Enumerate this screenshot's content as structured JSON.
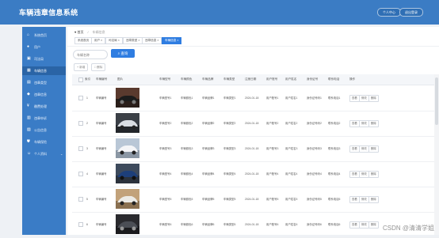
{
  "app": {
    "title": "车辆违章信息系统",
    "top_buttons": [
      "个人中心",
      "退出登录"
    ]
  },
  "sidebar": {
    "items": [
      {
        "label": "系统首页",
        "icon": "home-icon"
      },
      {
        "label": "用户",
        "icon": "user-icon"
      },
      {
        "label": "司法局",
        "icon": "building-icon"
      },
      {
        "label": "车辆信息",
        "icon": "car-icon",
        "active": true
      },
      {
        "label": "违章类型",
        "icon": "list-icon"
      },
      {
        "label": "违章信息",
        "icon": "warning-icon"
      },
      {
        "label": "缴费处理",
        "icon": "money-icon"
      },
      {
        "label": "违章申诉",
        "icon": "appeal-icon"
      },
      {
        "label": "公告信息",
        "icon": "notice-icon"
      },
      {
        "label": "车辆保险",
        "icon": "shield-icon"
      },
      {
        "label": "个人资料",
        "icon": "person-icon",
        "has_submenu": true
      }
    ]
  },
  "breadcrumb": {
    "home": "首页",
    "current": "车辆信息"
  },
  "tags": [
    {
      "label": "系统首页"
    },
    {
      "label": "用户 ×"
    },
    {
      "label": "司法局 ×"
    },
    {
      "label": "违章类型 ×"
    },
    {
      "label": "违章信息 ×"
    },
    {
      "label": "车辆信息 ×",
      "active": true
    }
  ],
  "search": {
    "placeholder": "车辆名称",
    "button_label": "查询"
  },
  "actions": {
    "add": "+ 新增",
    "delete": "删除"
  },
  "table": {
    "columns": [
      "索引",
      "车辆编号",
      "图片",
      "车辆型号",
      "车辆颜色",
      "车辆品牌",
      "车辆类型",
      "注册日期",
      "用户账号",
      "用户姓名",
      "身份证号",
      "联系电话",
      "操作"
    ],
    "rows": [
      {
        "index": "1",
        "vehicle_no": "车辆编号",
        "model": "车辆型号1",
        "color": "车辆颜色1",
        "brand": "车辆品牌1",
        "type": "车辆类型1",
        "date": "2024-01-18",
        "account": "用户账号1",
        "name": "用户姓名1",
        "id_no": "身份证号码1",
        "phone": "联系电话1"
      },
      {
        "index": "2",
        "vehicle_no": "车辆编号",
        "model": "车辆型号2",
        "color": "车辆颜色2",
        "brand": "车辆品牌2",
        "type": "车辆类型2",
        "date": "2024-01-18",
        "account": "用户账号2",
        "name": "用户姓名2",
        "id_no": "身份证号码2",
        "phone": "联系电话2"
      },
      {
        "index": "3",
        "vehicle_no": "车辆编号",
        "model": "车辆型号3",
        "color": "车辆颜色3",
        "brand": "车辆品牌3",
        "type": "车辆类型3",
        "date": "2024-01-18",
        "account": "用户账号3",
        "name": "用户姓名3",
        "id_no": "身份证号码3",
        "phone": "联系电话3"
      },
      {
        "index": "4",
        "vehicle_no": "车辆编号",
        "model": "车辆型号4",
        "color": "车辆颜色4",
        "brand": "车辆品牌4",
        "type": "车辆类型4",
        "date": "2024-01-18",
        "account": "用户账号4",
        "name": "用户姓名4",
        "id_no": "身份证号码4",
        "phone": "联系电话4"
      },
      {
        "index": "5",
        "vehicle_no": "车辆编号",
        "model": "车辆型号5",
        "color": "车辆颜色5",
        "brand": "车辆品牌5",
        "type": "车辆类型5",
        "date": "2024-01-18",
        "account": "用户账号5",
        "name": "用户姓名5",
        "id_no": "身份证号码5",
        "phone": "联系电话5"
      },
      {
        "index": "6",
        "vehicle_no": "车辆编号",
        "model": "车辆型号6",
        "color": "车辆颜色6",
        "brand": "车辆品牌6",
        "type": "车辆类型6",
        "date": "2024-01-18",
        "account": "用户账号6",
        "name": "用户姓名6",
        "id_no": "身份证号码6",
        "phone": "联系电话6"
      }
    ],
    "row_actions": [
      "查看",
      "修改",
      "删除"
    ]
  },
  "watermark": "CSDN @清清学姐",
  "colors": {
    "header": "#3b7cc4",
    "sidebar": "#3a7cc6",
    "sidebar_active": "#2a64a6",
    "primary": "#2f7de1"
  }
}
